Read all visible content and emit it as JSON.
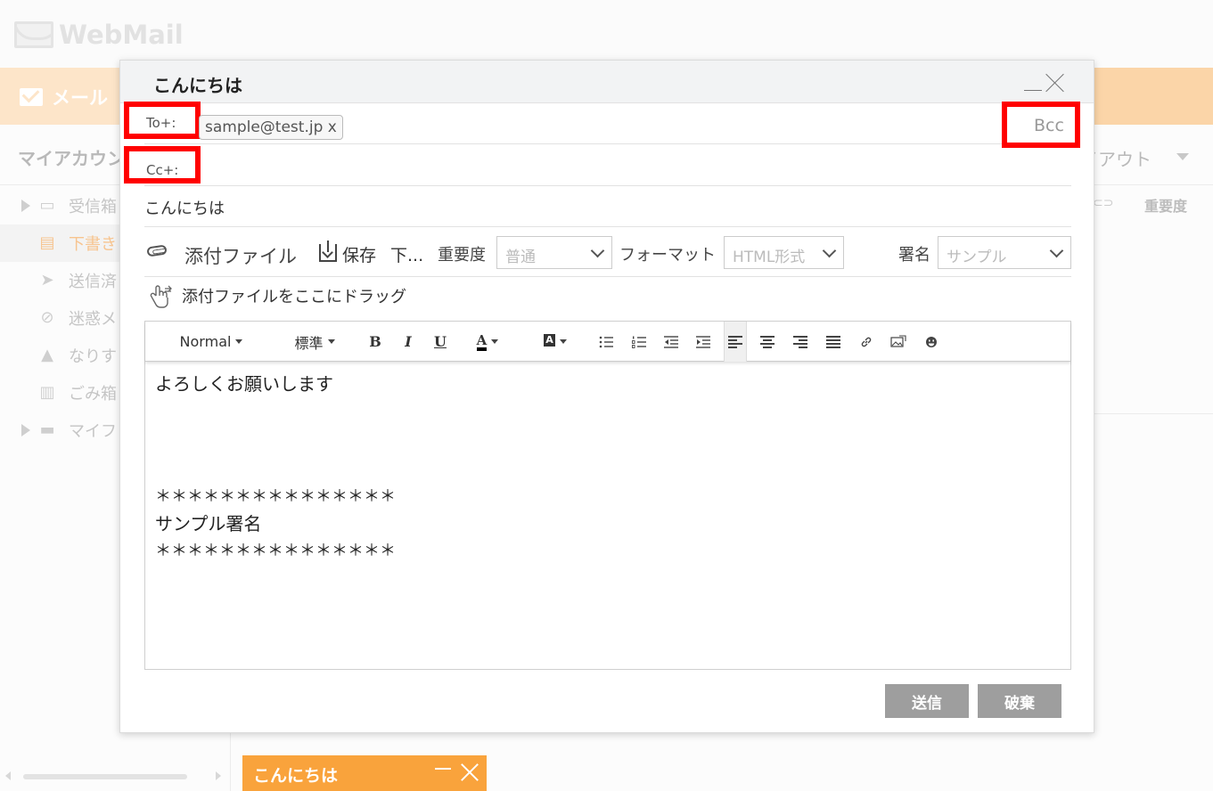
{
  "app": {
    "logo_text": "WebMail",
    "nav_mail_label": "メール",
    "account_label": "マイアカウン",
    "layout_label": "イアウト",
    "col_importance": "重要度"
  },
  "sidebar": {
    "items": [
      {
        "label": "受信箱",
        "icon": "inbox-icon",
        "has_arrow": true
      },
      {
        "label": "下書き",
        "icon": "draft-icon",
        "active": true
      },
      {
        "label": "送信済",
        "icon": "send-icon"
      },
      {
        "label": "迷惑メ",
        "icon": "spam-icon"
      },
      {
        "label": "なりす",
        "icon": "warning-icon"
      },
      {
        "label": "ごみ箱",
        "icon": "trash-icon"
      },
      {
        "label": "マイフ",
        "icon": "folder-icon",
        "has_arrow": true
      }
    ]
  },
  "minimized_tab": {
    "title": "こんにちは"
  },
  "compose": {
    "title": "こんにちは",
    "to_label": "To+:",
    "cc_label": "Cc+:",
    "bcc_label": "Bcc",
    "to_recipients": [
      "sample@test.jp x"
    ],
    "subject": "こんにちは",
    "attach_label": "添付ファイル",
    "save_label": "保存",
    "draft_label": "下...",
    "importance_label": "重要度",
    "importance_value": "普通",
    "format_label": "フォーマット",
    "format_value": "HTML形式",
    "signature_label": "署名",
    "signature_value": "サンプル",
    "drag_hint": "添付ファイルをここにドラッグ",
    "toolbar": {
      "font_format": "Normal",
      "font_size": "標準",
      "bold": "B",
      "italic": "I",
      "underline": "U",
      "font_color": "A",
      "bg_color": "A"
    },
    "body_lines": [
      "よろしくお願いします",
      "＊＊＊＊＊＊＊＊＊＊＊＊＊＊＊",
      "サンプル署名",
      "＊＊＊＊＊＊＊＊＊＊＊＊＊＊＊"
    ],
    "send_label": "送信",
    "discard_label": "破棄"
  },
  "colors": {
    "accent_orange": "#f9a33c",
    "highlight_red": "#ff0000",
    "button_gray": "#9e9e9e"
  }
}
